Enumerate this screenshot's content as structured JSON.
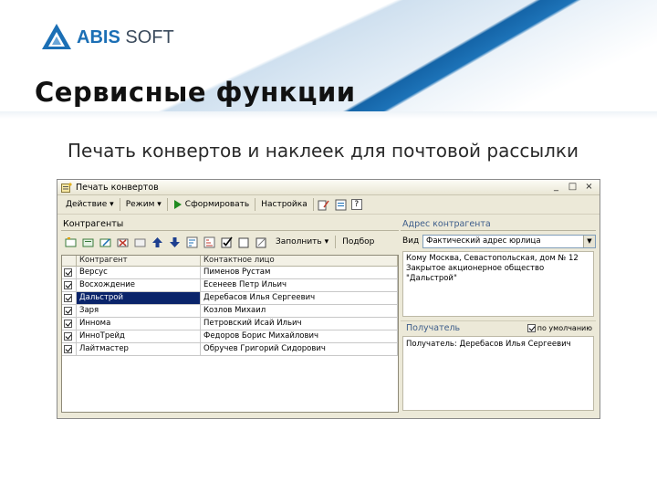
{
  "brand": {
    "logo_bold": "ABIS",
    "logo_light": " SOFT"
  },
  "slide": {
    "title": "Сервисные функции",
    "subtitle": "Печать конвертов и наклеек для почтовой рассылки"
  },
  "window": {
    "title": "Печать конвертов",
    "controls": [
      "_",
      "□",
      "×"
    ]
  },
  "toolbar": {
    "action_label": "Действие ▾",
    "mode_label": "Режим ▾",
    "generate_label": "Сформировать",
    "settings_label": "Настройка",
    "help_label": "?"
  },
  "contractors": {
    "section_title": "Контрагенты",
    "fill_label": "Заполнить ▾",
    "select_label": "Подбор",
    "columns": [
      "Контрагент",
      "Контактное лицо"
    ],
    "rows": [
      {
        "name": "Версус",
        "contact": "Пименов Рустам",
        "checked": true,
        "selected": false
      },
      {
        "name": "Восхождение",
        "contact": "Есенеев Петр Ильич",
        "checked": true,
        "selected": false
      },
      {
        "name": "Дальстрой",
        "contact": "Деребасов Илья Сергеевич",
        "checked": true,
        "selected": true
      },
      {
        "name": "Заря",
        "contact": "Козлов Михаил",
        "checked": true,
        "selected": false
      },
      {
        "name": "Иннома",
        "contact": "Петровский Исай Ильич",
        "checked": true,
        "selected": false
      },
      {
        "name": "ИнноТрейд",
        "contact": "Федоров Борис Михайлович",
        "checked": true,
        "selected": false
      },
      {
        "name": "Лайтмастер",
        "contact": "Обручев Григорий Сидорович",
        "checked": true,
        "selected": false
      }
    ]
  },
  "address": {
    "section_title": "Адрес контрагента",
    "kind_label": "Вид",
    "kind_value": "Фактический адрес юрлица",
    "line1": "Кому Москва, Севастопольская, дом № 12",
    "line2": "Закрытое акционерное общество \"Дальстрой\""
  },
  "recipient": {
    "section_title": "Получатель",
    "checkbox_label": "по умолчанию",
    "text": "Получатель: Деребасов Илья Сергеевич"
  },
  "colors": {
    "accent": "#1b6fb5",
    "selection": "#0a246a",
    "window_bg": "#ece9d8"
  }
}
